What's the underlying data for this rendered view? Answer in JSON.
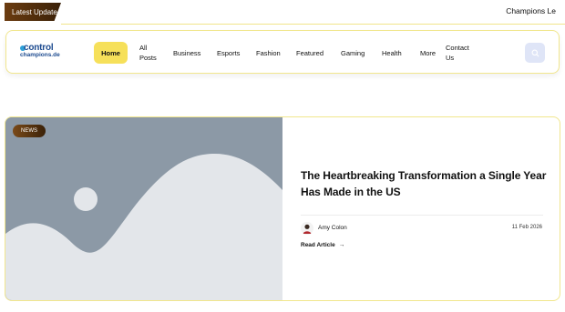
{
  "ticker": {
    "badge_label": "Latest Update",
    "headline": "Champions Le"
  },
  "header": {
    "logo_top": "control",
    "logo_bottom": "champions.de",
    "nav": {
      "home": "Home",
      "all_posts_line1": "All",
      "all_posts_line2": "Posts",
      "business": "Business",
      "esports": "Esports",
      "fashion": "Fashion",
      "featured": "Featured",
      "gaming": "Gaming",
      "health": "Health",
      "more": "More",
      "contact_line1": "Contact",
      "contact_line2": "Us"
    },
    "search_icon": "search-icon"
  },
  "article": {
    "category": "NEWS",
    "title": "The Heartbreaking Transformation a Single Year Has Made in the US",
    "author": "Amy Colon",
    "date": "11 Feb 2026",
    "read_label": "Read Article",
    "read_arrow": "→"
  },
  "colors": {
    "accent_yellow": "#f6e05a",
    "border_yellow": "#f1e68d",
    "badge_brown": "#5a3310",
    "placeholder_gray": "#8c99a6",
    "logo_blue": "#1c4a8f"
  }
}
